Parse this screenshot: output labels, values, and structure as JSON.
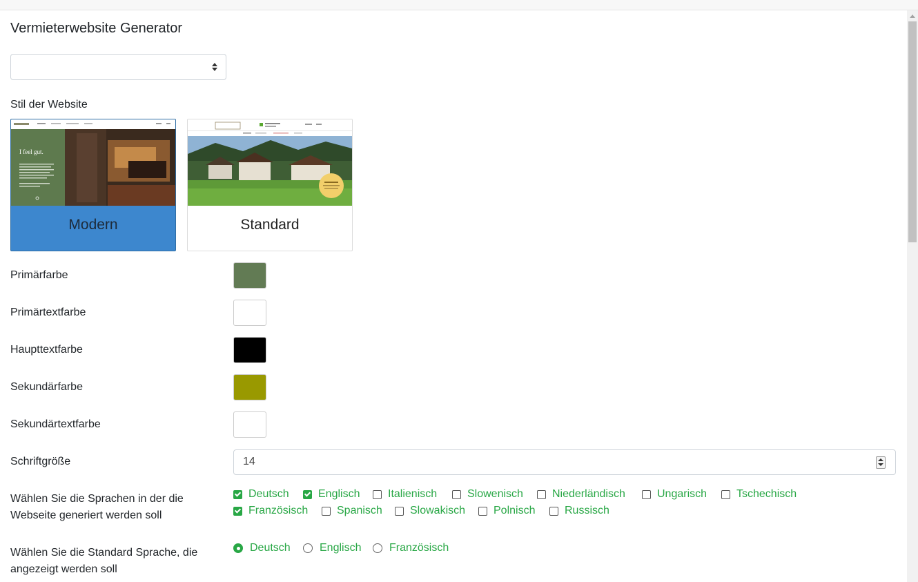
{
  "page": {
    "title": "Vermieterwebsite Generator"
  },
  "select": {
    "value": ""
  },
  "style_section": {
    "label": "Stil der Website",
    "options": [
      {
        "label": "Modern",
        "selected": true,
        "preview_text": "I feel gut."
      },
      {
        "label": "Standard",
        "selected": false
      }
    ]
  },
  "colors": [
    {
      "label": "Primärfarbe",
      "value": "#627b54"
    },
    {
      "label": "Primärtextfarbe",
      "value": "#ffffff"
    },
    {
      "label": "Haupttextfarbe",
      "value": "#000000"
    },
    {
      "label": "Sekundärfarbe",
      "value": "#999900"
    },
    {
      "label": "Sekundärtextfarbe",
      "value": "#ffffff"
    }
  ],
  "font_size": {
    "label": "Schriftgröße",
    "value": "14"
  },
  "languages": {
    "label": "Wählen Sie die Sprachen in der die Webseite generiert werden soll",
    "options": [
      {
        "label": "Deutsch",
        "checked": true
      },
      {
        "label": "Englisch",
        "checked": true
      },
      {
        "label": "Italienisch",
        "checked": false
      },
      {
        "label": "Slowenisch",
        "checked": false
      },
      {
        "label": "Niederländisch",
        "checked": false
      },
      {
        "label": "Ungarisch",
        "checked": false
      },
      {
        "label": "Tschechisch",
        "checked": false
      },
      {
        "label": "Französisch",
        "checked": true
      },
      {
        "label": "Spanisch",
        "checked": false
      },
      {
        "label": "Slowakisch",
        "checked": false
      },
      {
        "label": "Polnisch",
        "checked": false
      },
      {
        "label": "Russisch",
        "checked": false
      }
    ]
  },
  "default_language": {
    "label": "Wählen Sie die Standard Sprache, die angezeigt werden soll",
    "options": [
      {
        "label": "Deutsch",
        "checked": true
      },
      {
        "label": "Englisch",
        "checked": false
      },
      {
        "label": "Französisch",
        "checked": false
      }
    ]
  },
  "accent_color": "#28a745"
}
